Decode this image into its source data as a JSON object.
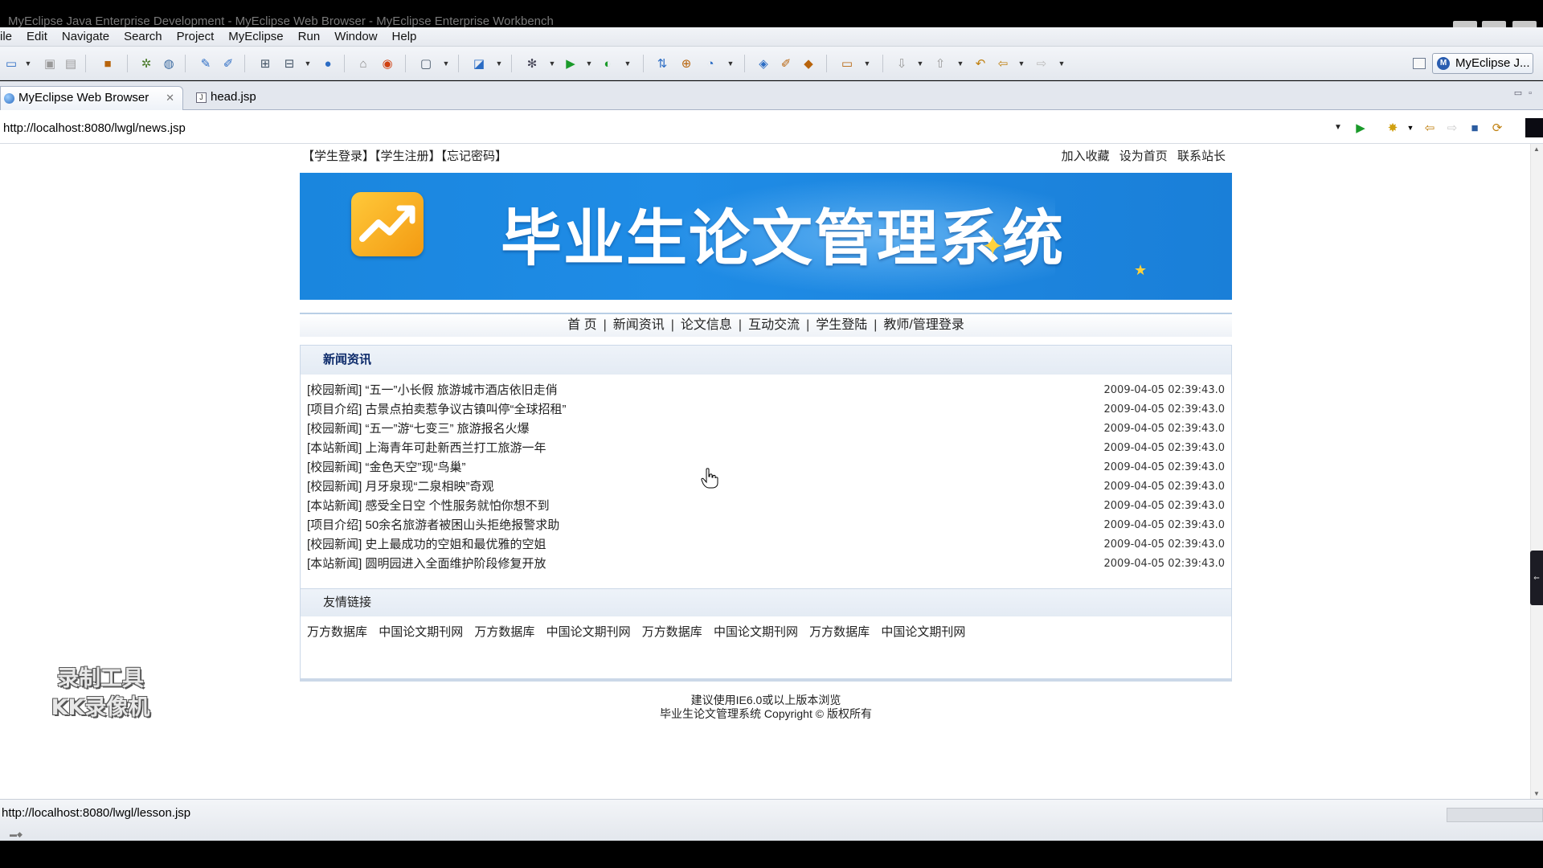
{
  "window": {
    "title": "MyEclipse Java Enterprise Development - MyEclipse Web Browser - MyEclipse Enterprise Workbench"
  },
  "menu": [
    "ile",
    "Edit",
    "Navigate",
    "Search",
    "Project",
    "MyEclipse",
    "Run",
    "Window",
    "Help"
  ],
  "perspective": {
    "label": "MyEclipse J..."
  },
  "tabs": {
    "browser": "MyEclipse Web Browser",
    "file": "head.jsp"
  },
  "address": {
    "url": "http://localhost:8080/lwgl/news.jsp"
  },
  "site": {
    "top_left": "【学生登录】【学生注册】【忘记密码】",
    "top_right": [
      "加入收藏",
      "设为首页",
      "联系站长"
    ],
    "banner_title": "毕业生论文管理系统",
    "nav": [
      "首 页",
      "新闻资讯",
      "论文信息",
      "互动交流",
      "学生登陆",
      "教师/管理登录"
    ],
    "news_heading": "新闻资讯",
    "news": [
      {
        "title": "[校园新闻] “五一”小长假 旅游城市酒店依旧走俏",
        "date": "2009-04-05 02:39:43.0"
      },
      {
        "title": "[项目介绍] 古景点拍卖惹争议古镇叫停“全球招租”",
        "date": "2009-04-05 02:39:43.0"
      },
      {
        "title": "[校园新闻] “五一”游“七变三” 旅游报名火爆",
        "date": "2009-04-05 02:39:43.0"
      },
      {
        "title": "[本站新闻] 上海青年可赴新西兰打工旅游一年",
        "date": "2009-04-05 02:39:43.0"
      },
      {
        "title": "[校园新闻] “金色天空”现“鸟巢”",
        "date": "2009-04-05 02:39:43.0"
      },
      {
        "title": "[校园新闻] 月牙泉现“二泉相映”奇观",
        "date": "2009-04-05 02:39:43.0"
      },
      {
        "title": "[本站新闻] 感受全日空 个性服务就怕你想不到",
        "date": "2009-04-05 02:39:43.0"
      },
      {
        "title": "[项目介绍] 50余名旅游者被困山头拒绝报警求助",
        "date": "2009-04-05 02:39:43.0"
      },
      {
        "title": "[校园新闻] 史上最成功的空姐和最优雅的空姐",
        "date": "2009-04-05 02:39:43.0"
      },
      {
        "title": "[本站新闻] 圆明园进入全面维护阶段修复开放",
        "date": "2009-04-05 02:39:43.0"
      }
    ],
    "links_heading": "友情链接",
    "links": [
      "万方数据库",
      "中国论文期刊网",
      "万方数据库",
      "中国论文期刊网",
      "万方数据库",
      "中国论文期刊网",
      "万方数据库",
      "中国论文期刊网"
    ],
    "footer_line1": "建议使用IE6.0或以上版本浏览",
    "footer_line2": "毕业生论文管理系统 Copyright © 版权所有"
  },
  "watermark": {
    "line1": "录制工具",
    "line2": "KK录像机"
  },
  "status": {
    "text": "http://localhost:8080/lwgl/lesson.jsp"
  },
  "colors": {
    "banner": "#1f8ce6",
    "nav_border": "#b9cfe6",
    "box_border": "#cbd8e8",
    "heading": "#0c2a6a"
  }
}
